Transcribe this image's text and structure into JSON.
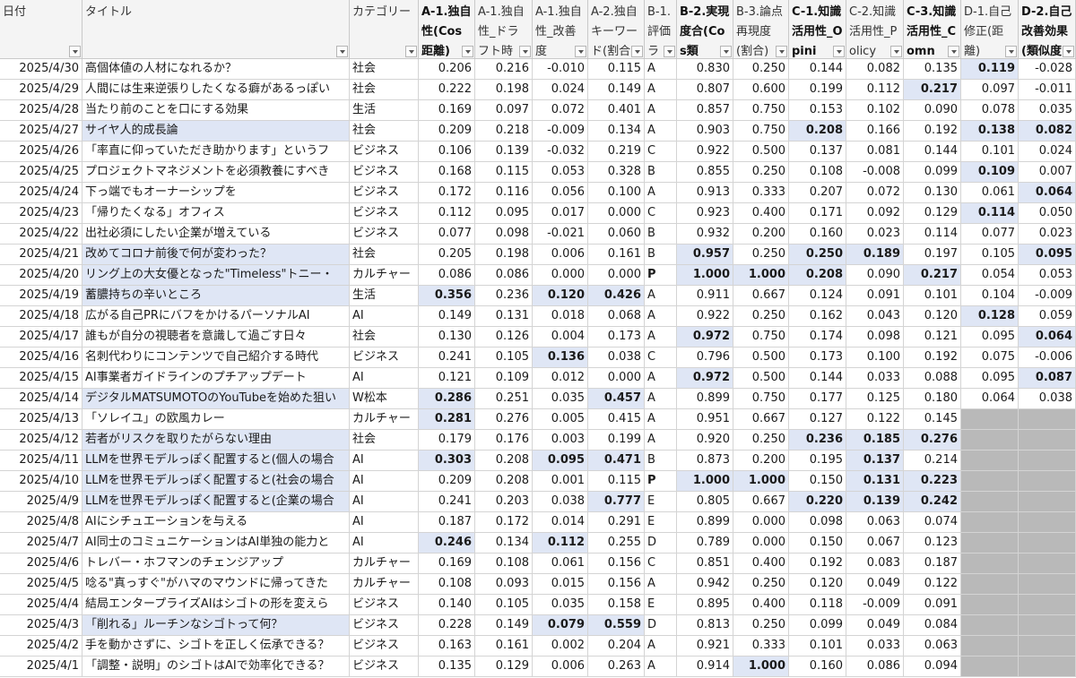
{
  "colors": {
    "highlight": "#dfe6f5",
    "empty_fill": "#b9b9b9",
    "header_bg": "#f4f4f4",
    "grid": "#d4d4d4"
  },
  "headers": [
    {
      "label": "日付",
      "bold": false
    },
    {
      "label": "タイトル",
      "bold": false
    },
    {
      "label": "カテゴリー",
      "bold": false
    },
    {
      "label": "A-1.独自性(Cos距離)",
      "bold": true
    },
    {
      "label": "A-1.独自性_ドラフト時",
      "bold": false
    },
    {
      "label": "A-1.独自性_改善度",
      "bold": false
    },
    {
      "label": "A-2.独自キーワード(割合)",
      "bold": false
    },
    {
      "label": "B-1.評価ラ",
      "bold": false
    },
    {
      "label": "B-2.実現度合(Cos類",
      "bold": true
    },
    {
      "label": "B-3.論点再現度(割合)",
      "bold": false
    },
    {
      "label": "C-1.知識活用性_Opini",
      "bold": true
    },
    {
      "label": "C-2.知識活用性_Policy",
      "bold": false
    },
    {
      "label": "C-3.知識活用性_Comn",
      "bold": true
    },
    {
      "label": "D-1.自己修正(距離)",
      "bold": false
    },
    {
      "label": "D-2.自己改善効果(類似度)",
      "bold": true
    }
  ],
  "rows": [
    {
      "cells": [
        "2025/4/30",
        "高個体値の人材になれるか？",
        "社会",
        "0.206",
        "0.216",
        "-0.010",
        "0.115",
        "A",
        "0.830",
        "0.250",
        "0.144",
        "0.082",
        "0.135",
        "0.119",
        "-0.028"
      ],
      "hl": [
        13
      ],
      "rowhl": false
    },
    {
      "cells": [
        "2025/4/29",
        "人間には生来逆張りしたくなる癖があるっぽい",
        "社会",
        "0.222",
        "0.198",
        "0.024",
        "0.149",
        "A",
        "0.807",
        "0.600",
        "0.199",
        "0.112",
        "0.217",
        "0.097",
        "-0.011"
      ],
      "hl": [
        12
      ],
      "rowhl": false
    },
    {
      "cells": [
        "2025/4/28",
        "当たり前のことを口にする効果",
        "生活",
        "0.169",
        "0.097",
        "0.072",
        "0.401",
        "A",
        "0.857",
        "0.750",
        "0.153",
        "0.102",
        "0.090",
        "0.078",
        "0.035"
      ],
      "hl": [],
      "rowhl": false
    },
    {
      "cells": [
        "2025/4/27",
        "サイヤ人的成長論",
        "社会",
        "0.209",
        "0.218",
        "-0.009",
        "0.134",
        "A",
        "0.903",
        "0.750",
        "0.208",
        "0.166",
        "0.192",
        "0.138",
        "0.082"
      ],
      "hl": [
        10,
        13,
        14
      ],
      "rowhl": true
    },
    {
      "cells": [
        "2025/4/26",
        "「率直に仰っていただき助かります」というフ",
        "ビジネス",
        "0.106",
        "0.139",
        "-0.032",
        "0.219",
        "C",
        "0.922",
        "0.500",
        "0.137",
        "0.081",
        "0.144",
        "0.101",
        "0.024"
      ],
      "hl": [],
      "rowhl": false
    },
    {
      "cells": [
        "2025/4/25",
        "プロジェクトマネジメントを必須教養にすべき",
        "ビジネス",
        "0.168",
        "0.115",
        "0.053",
        "0.328",
        "B",
        "0.855",
        "0.250",
        "0.108",
        "-0.008",
        "0.099",
        "0.109",
        "0.007"
      ],
      "hl": [
        13
      ],
      "rowhl": false
    },
    {
      "cells": [
        "2025/4/24",
        "下っ端でもオーナーシップを",
        "ビジネス",
        "0.172",
        "0.116",
        "0.056",
        "0.100",
        "A",
        "0.913",
        "0.333",
        "0.207",
        "0.072",
        "0.130",
        "0.061",
        "0.064"
      ],
      "hl": [
        14
      ],
      "rowhl": false
    },
    {
      "cells": [
        "2025/4/23",
        "「帰りたくなる」オフィス",
        "ビジネス",
        "0.112",
        "0.095",
        "0.017",
        "0.000",
        "C",
        "0.923",
        "0.400",
        "0.171",
        "0.092",
        "0.129",
        "0.114",
        "0.050"
      ],
      "hl": [
        13
      ],
      "rowhl": false
    },
    {
      "cells": [
        "2025/4/22",
        "出社必須にしたい企業が増えている",
        "ビジネス",
        "0.077",
        "0.098",
        "-0.021",
        "0.060",
        "B",
        "0.932",
        "0.200",
        "0.160",
        "0.023",
        "0.114",
        "0.077",
        "0.023"
      ],
      "hl": [],
      "rowhl": false
    },
    {
      "cells": [
        "2025/4/21",
        "改めてコロナ前後で何が変わった？",
        "社会",
        "0.205",
        "0.198",
        "0.006",
        "0.161",
        "B",
        "0.957",
        "0.250",
        "0.250",
        "0.189",
        "0.197",
        "0.105",
        "0.095"
      ],
      "hl": [
        8,
        10,
        11,
        14
      ],
      "rowhl": true
    },
    {
      "cells": [
        "2025/4/20",
        "リング上の大女優となった\"Timeless\"トニー・",
        "カルチャー",
        "0.086",
        "0.086",
        "0.000",
        "0.000",
        "P",
        "1.000",
        "1.000",
        "0.208",
        "0.090",
        "0.217",
        "0.054",
        "0.053"
      ],
      "hl": [
        8,
        9,
        10,
        12
      ],
      "bold": [
        7
      ],
      "rowhl": true
    },
    {
      "cells": [
        "2025/4/19",
        "蓄膿持ちの辛いところ",
        "生活",
        "0.356",
        "0.236",
        "0.120",
        "0.426",
        "A",
        "0.911",
        "0.667",
        "0.124",
        "0.091",
        "0.101",
        "0.104",
        "-0.009"
      ],
      "hl": [
        3,
        5,
        6
      ],
      "rowhl": true
    },
    {
      "cells": [
        "2025/4/18",
        "広がる自己PRにバフをかけるパーソナルAI",
        "AI",
        "0.149",
        "0.131",
        "0.018",
        "0.068",
        "A",
        "0.922",
        "0.250",
        "0.162",
        "0.043",
        "0.120",
        "0.128",
        "0.059"
      ],
      "hl": [
        13
      ],
      "rowhl": false
    },
    {
      "cells": [
        "2025/4/17",
        "誰もが自分の視聴者を意識して過ごす日々",
        "社会",
        "0.130",
        "0.126",
        "0.004",
        "0.173",
        "A",
        "0.972",
        "0.750",
        "0.174",
        "0.098",
        "0.121",
        "0.095",
        "0.064"
      ],
      "hl": [
        8,
        14
      ],
      "rowhl": false
    },
    {
      "cells": [
        "2025/4/16",
        "名刺代わりにコンテンツで自己紹介する時代",
        "ビジネス",
        "0.241",
        "0.105",
        "0.136",
        "0.038",
        "C",
        "0.796",
        "0.500",
        "0.173",
        "0.100",
        "0.192",
        "0.075",
        "-0.006"
      ],
      "hl": [
        5
      ],
      "rowhl": false
    },
    {
      "cells": [
        "2025/4/15",
        "AI事業者ガイドラインのプチアップデート",
        "AI",
        "0.121",
        "0.109",
        "0.012",
        "0.000",
        "A",
        "0.972",
        "0.500",
        "0.144",
        "0.033",
        "0.088",
        "0.095",
        "0.087"
      ],
      "hl": [
        8,
        14
      ],
      "rowhl": false
    },
    {
      "cells": [
        "2025/4/14",
        "デジタルMATSUMOTOのYouTubeを始めた狙い",
        "W松本",
        "0.286",
        "0.251",
        "0.035",
        "0.457",
        "A",
        "0.899",
        "0.750",
        "0.177",
        "0.125",
        "0.180",
        "0.064",
        "0.038"
      ],
      "hl": [
        3,
        6
      ],
      "rowhl": true
    },
    {
      "cells": [
        "2025/4/13",
        "「ソレイユ」の欧風カレー",
        "カルチャー",
        "0.281",
        "0.276",
        "0.005",
        "0.415",
        "A",
        "0.951",
        "0.667",
        "0.127",
        "0.122",
        "0.145",
        "",
        ""
      ],
      "hl": [
        3
      ],
      "grey": [
        13,
        14
      ],
      "rowhl": false
    },
    {
      "cells": [
        "2025/4/12",
        "若者がリスクを取りたがらない理由",
        "社会",
        "0.179",
        "0.176",
        "0.003",
        "0.199",
        "A",
        "0.920",
        "0.250",
        "0.236",
        "0.185",
        "0.276",
        "",
        ""
      ],
      "hl": [
        10,
        11,
        12
      ],
      "grey": [
        13,
        14
      ],
      "rowhl": true
    },
    {
      "cells": [
        "2025/4/11",
        "LLMを世界モデルっぽく配置すると(個人の場合",
        "AI",
        "0.303",
        "0.208",
        "0.095",
        "0.471",
        "B",
        "0.873",
        "0.200",
        "0.195",
        "0.137",
        "0.214",
        "",
        ""
      ],
      "hl": [
        3,
        5,
        6,
        11
      ],
      "grey": [
        13,
        14
      ],
      "rowhl": true
    },
    {
      "cells": [
        "2025/4/10",
        "LLMを世界モデルっぽく配置すると(社会の場合",
        "AI",
        "0.209",
        "0.208",
        "0.001",
        "0.115",
        "P",
        "1.000",
        "1.000",
        "0.150",
        "0.131",
        "0.223",
        "",
        ""
      ],
      "hl": [
        8,
        9,
        11,
        12
      ],
      "bold": [
        7
      ],
      "grey": [
        13,
        14
      ],
      "rowhl": true
    },
    {
      "cells": [
        "2025/4/9",
        "LLMを世界モデルっぽく配置すると(企業の場合",
        "AI",
        "0.241",
        "0.203",
        "0.038",
        "0.777",
        "E",
        "0.805",
        "0.667",
        "0.220",
        "0.139",
        "0.242",
        "",
        ""
      ],
      "hl": [
        6,
        10,
        11,
        12
      ],
      "grey": [
        13,
        14
      ],
      "rowhl": true
    },
    {
      "cells": [
        "2025/4/8",
        "AIにシチュエーションを与える",
        "AI",
        "0.187",
        "0.172",
        "0.014",
        "0.291",
        "E",
        "0.899",
        "0.000",
        "0.098",
        "0.063",
        "0.074",
        "",
        ""
      ],
      "hl": [],
      "grey": [
        13,
        14
      ],
      "rowhl": false
    },
    {
      "cells": [
        "2025/4/7",
        "AI同士のコミュニケーションはAI単独の能力と",
        "AI",
        "0.246",
        "0.134",
        "0.112",
        "0.255",
        "D",
        "0.789",
        "0.000",
        "0.150",
        "0.067",
        "0.123",
        "",
        ""
      ],
      "hl": [
        3,
        5
      ],
      "grey": [
        13,
        14
      ],
      "rowhl": false
    },
    {
      "cells": [
        "2025/4/6",
        "トレバー・ホフマンのチェンジアップ",
        "カルチャー",
        "0.169",
        "0.108",
        "0.061",
        "0.156",
        "C",
        "0.851",
        "0.400",
        "0.192",
        "0.083",
        "0.187",
        "",
        ""
      ],
      "hl": [],
      "grey": [
        13,
        14
      ],
      "rowhl": false
    },
    {
      "cells": [
        "2025/4/5",
        "唸る\"真っすぐ\"がハマのマウンドに帰ってきた",
        "カルチャー",
        "0.108",
        "0.093",
        "0.015",
        "0.156",
        "A",
        "0.942",
        "0.250",
        "0.120",
        "0.049",
        "0.122",
        "",
        ""
      ],
      "hl": [],
      "grey": [
        13,
        14
      ],
      "rowhl": false
    },
    {
      "cells": [
        "2025/4/4",
        "結局エンタープライズAIはシゴトの形を変えら",
        "ビジネス",
        "0.140",
        "0.105",
        "0.035",
        "0.158",
        "E",
        "0.895",
        "0.400",
        "0.118",
        "-0.009",
        "0.091",
        "",
        ""
      ],
      "hl": [],
      "grey": [
        13,
        14
      ],
      "rowhl": false
    },
    {
      "cells": [
        "2025/4/3",
        "「削れる」ルーチンなシゴトって何？",
        "ビジネス",
        "0.228",
        "0.149",
        "0.079",
        "0.559",
        "D",
        "0.813",
        "0.250",
        "0.099",
        "0.049",
        "0.084",
        "",
        ""
      ],
      "hl": [
        5,
        6
      ],
      "grey": [
        13,
        14
      ],
      "rowhl": true
    },
    {
      "cells": [
        "2025/4/2",
        "手を動かさずに、シゴトを正しく伝承できる？",
        "ビジネス",
        "0.163",
        "0.161",
        "0.002",
        "0.204",
        "A",
        "0.921",
        "0.333",
        "0.101",
        "0.033",
        "0.063",
        "",
        ""
      ],
      "hl": [],
      "grey": [
        13,
        14
      ],
      "rowhl": false
    },
    {
      "cells": [
        "2025/4/1",
        "「調整・説明」のシゴトはAIで効率化できる？",
        "ビジネス",
        "0.135",
        "0.129",
        "0.006",
        "0.263",
        "A",
        "0.914",
        "1.000",
        "0.160",
        "0.086",
        "0.094",
        "",
        ""
      ],
      "hl": [
        9
      ],
      "grey": [
        13,
        14
      ],
      "rowhl": false
    }
  ]
}
